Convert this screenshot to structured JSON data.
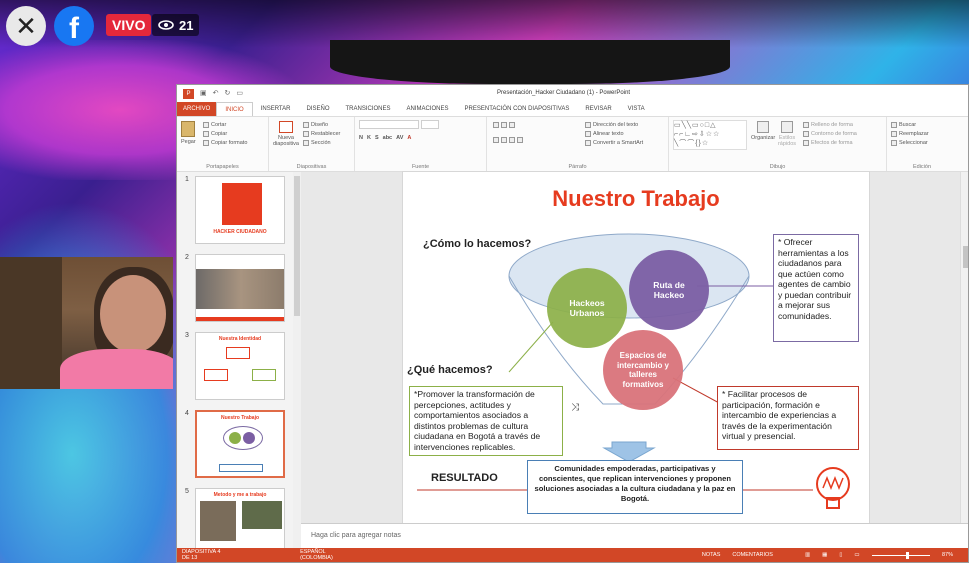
{
  "stream": {
    "close_glyph": "✕",
    "fb_logo": "f",
    "live_label": "VIVO",
    "viewer_count": "21"
  },
  "ppt": {
    "window_title": "Presentación_Hacker Ciudadano (1) - PowerPoint",
    "tabs": [
      "ARCHIVO",
      "INICIO",
      "INSERTAR",
      "DISEÑO",
      "TRANSICIONES",
      "ANIMACIONES",
      "PRESENTACIÓN CON DIAPOSITIVAS",
      "REVISAR",
      "VISTA"
    ],
    "ribbon": {
      "portapapeles": {
        "label": "Portapapeles",
        "paste": "Pegar",
        "cut": "Cortar",
        "copy": "Copiar",
        "format": "Copiar formato"
      },
      "diapositivas": {
        "label": "Diapositivas",
        "new": "Nueva diapositiva",
        "layout": "Diseño",
        "reset": "Restablecer",
        "section": "Sección"
      },
      "fuente": {
        "label": "Fuente"
      },
      "parrafo": {
        "label": "Párrafo",
        "text_dir": "Dirección del texto",
        "align": "Alinear texto",
        "smartart": "Convertir a SmartArt"
      },
      "dibujo": {
        "label": "Dibujo",
        "arrange": "Organizar",
        "styles": "Estilos rápidos",
        "fill": "Relleno de forma",
        "outline": "Contorno de forma",
        "effects": "Efectos de forma"
      },
      "edicion": {
        "label": "Edición",
        "find": "Buscar",
        "replace": "Reemplazar",
        "select": "Seleccionar"
      }
    },
    "thumbnails": [
      {
        "num": "1",
        "title": "HACKER CIUDADANO"
      },
      {
        "num": "2",
        "title": ""
      },
      {
        "num": "3",
        "title": "Nuestra Identidad"
      },
      {
        "num": "4",
        "title": "Nuestro Trabajo"
      },
      {
        "num": "5",
        "title": "Metodo y me a trabajo"
      }
    ],
    "notes_placeholder": "Haga clic para agregar notas",
    "status": {
      "slide": "DIAPOSITIVA 4 DE 13",
      "language": "ESPAÑOL (COLOMBIA)",
      "notes": "NOTAS",
      "comments": "COMENTARIOS",
      "zoom": "87%"
    }
  },
  "slide": {
    "title": "Nuestro Trabajo",
    "how_heading": "¿Cómo lo hacemos?",
    "what_heading": "¿Qué hacemos?",
    "circle_hackeos": "Hackeos Urbanos",
    "circle_ruta": "Ruta de Hackeo",
    "circle_espacios": "Espacios de intercambio y talleres formativos",
    "box_purple": "* Ofrecer herramientas a los ciudadanos para que actúen como agentes de cambio y puedan contribuir a mejorar sus comunidades.",
    "box_green": "*Promover la transformación de percepciones, actitudes y comportamientos asociados a distintos problemas de cultura ciudadana en Bogotá a través de intervenciones replicables.",
    "box_red": "* Facilitar procesos de participación, formación e intercambio de experiencias a través de la experimentación virtual y presencial.",
    "resultado_label": "RESULTADO",
    "result_box": "Comunidades empoderadas, participativas y conscientes, que replican intervenciones y proponen soluciones asociadas a la cultura ciudadana y la paz en Bogotá.",
    "colors": {
      "title": "#e63b1f",
      "green": "#8cb048",
      "purple": "#7b5ea3",
      "pink": "#d9737a",
      "blue_arrow": "#9ec3e6"
    }
  }
}
